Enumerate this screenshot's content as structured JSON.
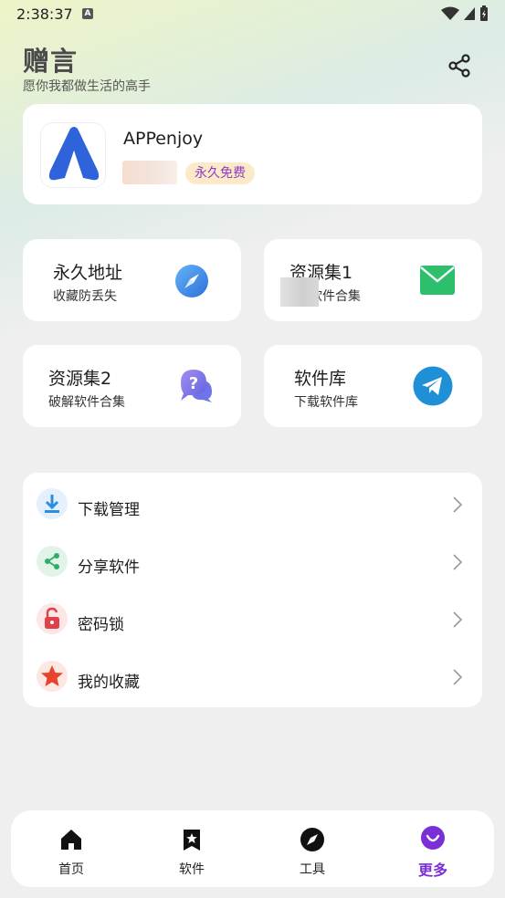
{
  "status_bar": {
    "time": "2:38:37"
  },
  "header": {
    "title": "赠言",
    "subtitle": "愿你我都做生活的高手"
  },
  "app_card": {
    "name": "APPenjoy",
    "badge": "永久免费"
  },
  "tiles": [
    {
      "title": "永久地址",
      "subtitle": "收藏防丢失",
      "icon": "compass-icon"
    },
    {
      "title": "资源集1",
      "subtitle": "软件合集",
      "icon": "mail-icon"
    },
    {
      "title": "资源集2",
      "subtitle": "破解软件合集",
      "icon": "question-chat-icon"
    },
    {
      "title": "软件库",
      "subtitle": "下载软件库",
      "icon": "telegram-icon"
    }
  ],
  "menu": [
    {
      "label": "下载管理",
      "icon": "download-icon"
    },
    {
      "label": "分享软件",
      "icon": "share-icon"
    },
    {
      "label": "密码锁",
      "icon": "lock-icon"
    },
    {
      "label": "我的收藏",
      "icon": "star-icon"
    }
  ],
  "bottom_nav": [
    {
      "label": "首页",
      "icon": "home-icon",
      "active": false
    },
    {
      "label": "软件",
      "icon": "bookmark-star-icon",
      "active": false
    },
    {
      "label": "工具",
      "icon": "compass-icon",
      "active": false
    },
    {
      "label": "更多",
      "icon": "smile-icon",
      "active": true
    }
  ],
  "colors": {
    "accent": "#7b2fd6",
    "badge_bg": "#fbe9c7",
    "compass_blue": "#3a7fe0",
    "mail_green": "#2dbf6c",
    "telegram_blue": "#1f8fd6",
    "download_blue": "#2b8fe0",
    "share_green": "#2fae6a",
    "lock_red": "#e0404a",
    "star_red": "#e8432f"
  }
}
